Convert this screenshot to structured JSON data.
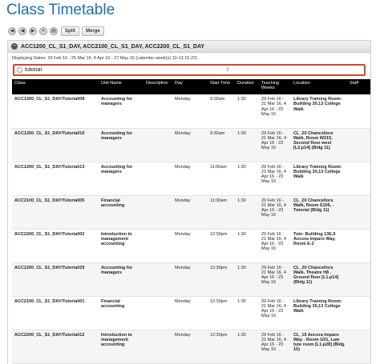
{
  "page": {
    "title": "Class Timetable"
  },
  "toolbar": {
    "icons": [
      "first-icon",
      "prev-icon",
      "next-icon",
      "close-icon",
      "print-icon"
    ],
    "split_label": "Split",
    "merge_label": "Merge"
  },
  "panel": {
    "title": "ACC1200_CL_S1_DAY, ACC2100_CL_S1_DAY, ACC2200_CL_S1_DAY",
    "displaying": "Displaying Dates: 29 Feb 16 - 25 Mar 16, 4 Apr 16 - 27 May 16 (calendar week(s) 10-13,15-22)"
  },
  "filter": {
    "value": "tutorial",
    "cursor_char": "I"
  },
  "table": {
    "headers": [
      "Class",
      "Unit Name",
      "Description",
      "Day",
      "Start Time",
      "Duration",
      "Teaching Weeks",
      "Location",
      "Staff"
    ],
    "rows": [
      {
        "class": "ACC1200_CL_S1_DAY/Tutorial/08",
        "unit": "Accounting for managers",
        "description": "",
        "day": "Monday",
        "start": "9:00am",
        "duration": "1:30",
        "weeks": "29 Feb 16 - 21 Mar 16, 4 Apr 16 - 23 May 16",
        "location": "Library Training Room: Building 30,13 College Walk",
        "staff": ""
      },
      {
        "class": "ACC1200_CL_S1_DAY/Tutorial/10",
        "unit": "Accounting for managers",
        "description": "",
        "day": "Monday",
        "start": "9:30am",
        "duration": "1:30",
        "weeks": "29 Feb 16 - 21 Mar 16, 4 Apr 16 - 23 May 16",
        "location": "CL_20 Chancellors Walk, Room W215, Second floor west [L2.p14] (Bldg 11)",
        "staff": ""
      },
      {
        "class": "ACC1200_CL_S1_DAY/Tutorial/13",
        "unit": "Accounting for managers",
        "description": "",
        "day": "Monday",
        "start": "11:00am",
        "duration": "1:30",
        "weeks": "29 Feb 16 - 21 Mar 16, 4 Apr 16 - 23 May 16",
        "location": "Library Training Room: Building 30,13 College Walk",
        "staff": ""
      },
      {
        "class": "ACC2100_CL_S1_DAY/Tutorial/05",
        "unit": "Financial accounting",
        "description": "",
        "day": "Monday",
        "start": "11:00am",
        "duration": "1:30",
        "weeks": "29 Feb 16 - 21 Mar 16, 4 Apr 16 - 23 May 16",
        "location": "CL_20 Chancellors Walk, Room S106, - Tutorial (Bldg 11)",
        "staff": ""
      },
      {
        "class": "ACC2200_CL_S1_DAY/Tutorial/02",
        "unit": "Introduction to management accounting",
        "description": "",
        "day": "Monday",
        "start": "12:00pm",
        "duration": "1:30",
        "weeks": "29 Feb 16 - 21 Mar 16, 4 Apr 16 - 23 May 16",
        "location": "Tute: Building 13E,9 Ancora Imparo Way, Room E-2",
        "staff": ""
      },
      {
        "class": "ACC1200_CL_S1_DAY/Tutorial/29",
        "unit": "Accounting for managers",
        "description": "",
        "day": "Monday",
        "start": "12:30pm",
        "duration": "1:30",
        "weeks": "29 Feb 16 - 21 Mar 16, 4 Apr 16 - 23 May 16",
        "location": "CL_20 Chancellors Walk, Theatre H8 , Ground floor [L1.p14] (Bldg 11)",
        "staff": ""
      },
      {
        "class": "ACC2100_CL_S1_DAY/Tutorial/01",
        "unit": "Financial accounting",
        "description": "",
        "day": "Monday",
        "start": "12:30pm",
        "duration": "1:30",
        "weeks": "29 Feb 16 - 21 Mar 16, 4 Apr 16 - 23 May 16",
        "location": "Library Training Room: Building 30,13 College Walk",
        "staff": ""
      },
      {
        "class": "ACC2200_CL_S1_DAY/Tutorial/12",
        "unit": "Introduction to management accounting",
        "description": "",
        "day": "Monday",
        "start": "12:30pm",
        "duration": "1:30",
        "weeks": "29 Feb 16 - 21 Mar 16, 4 Apr 16 - 23 May 16",
        "location": "CL_15 Ancora Imparo Way - Room G01, Law tute room [L1.p28] (Bldg 15)",
        "staff": ""
      }
    ]
  }
}
